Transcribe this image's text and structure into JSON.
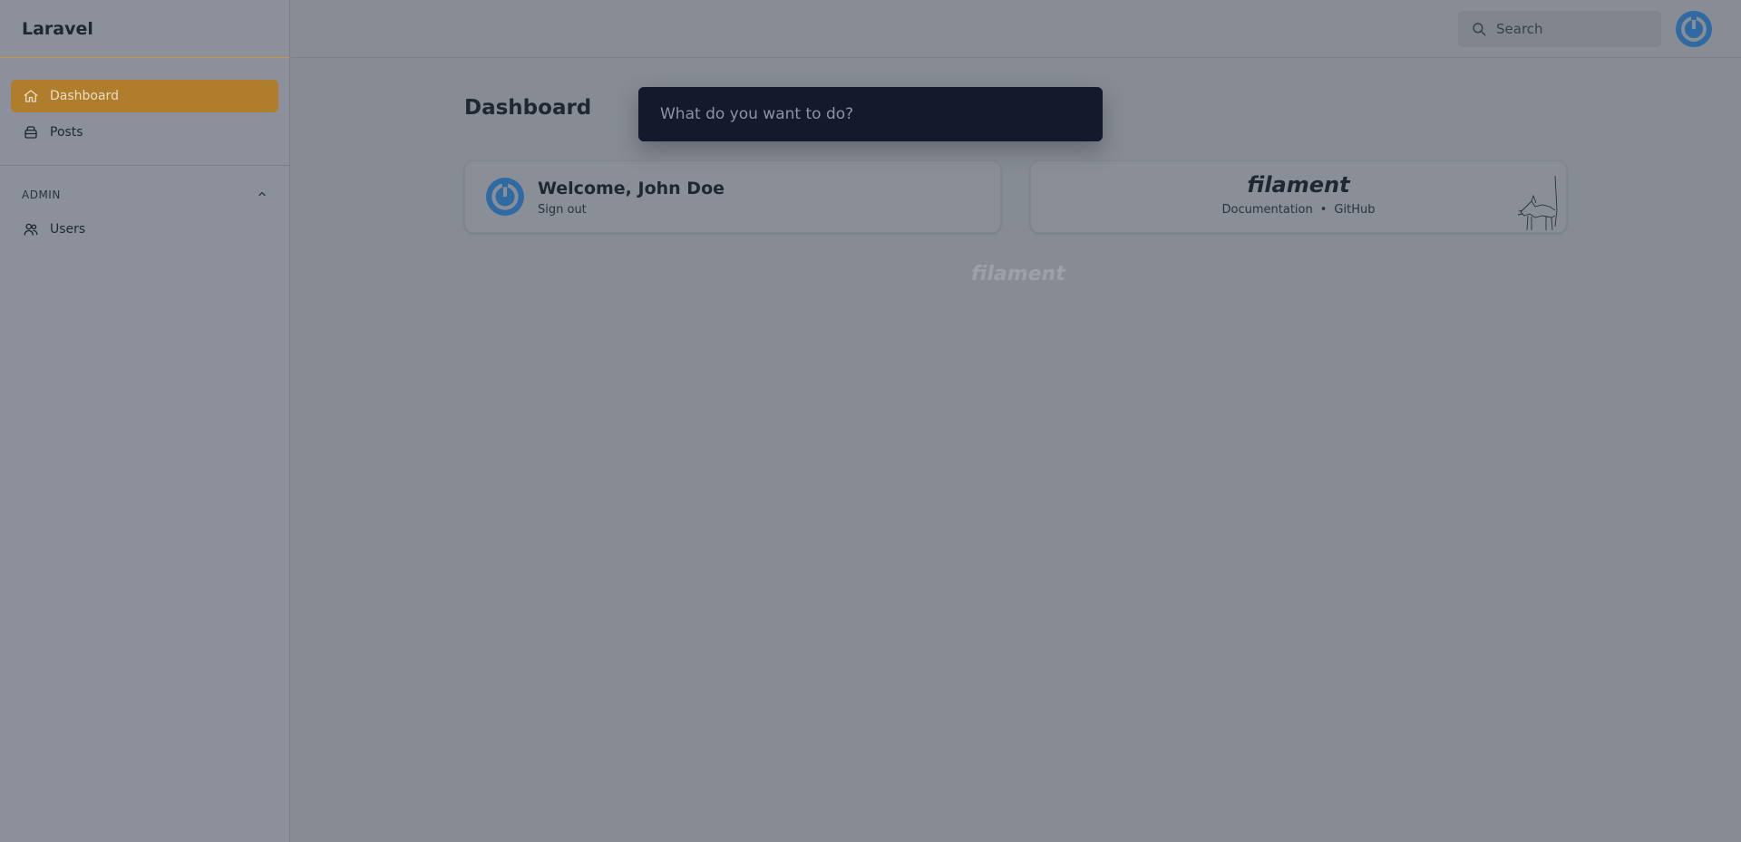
{
  "app": {
    "brand": "Laravel"
  },
  "sidebar": {
    "items": [
      {
        "label": "Dashboard",
        "icon": "home-icon",
        "active": true
      },
      {
        "label": "Posts",
        "icon": "inbox-icon",
        "active": false
      }
    ],
    "group": {
      "label": "ADMIN",
      "items": [
        {
          "label": "Users",
          "icon": "users-icon"
        }
      ]
    }
  },
  "topbar": {
    "search_placeholder": "Search"
  },
  "page": {
    "title": "Dashboard"
  },
  "welcome": {
    "greeting": "Welcome, John Doe",
    "signout": "Sign out"
  },
  "filament_card": {
    "logo": "filament",
    "docs": "Documentation",
    "separator": "•",
    "github": "GitHub"
  },
  "footer": {
    "logo": "filament"
  },
  "palette": {
    "placeholder": "What do you want to do?"
  },
  "colors": {
    "accent": "#b07d2c",
    "palette_bg": "#141a2b",
    "avatar": "#2f6aa3"
  }
}
